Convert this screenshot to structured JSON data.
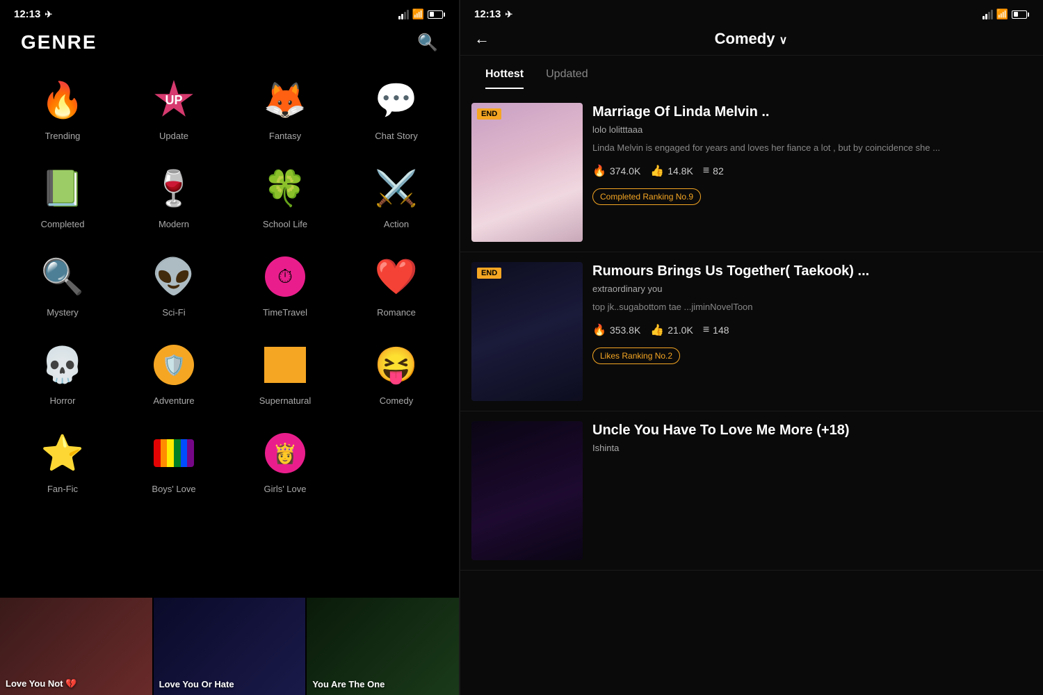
{
  "left": {
    "statusBar": {
      "time": "12:13",
      "location": "↗"
    },
    "title": "GENRE",
    "searchLabel": "search",
    "genres": [
      {
        "id": "trending",
        "label": "Trending",
        "emoji": "🔥"
      },
      {
        "id": "update",
        "label": "Update",
        "emoji": "🔼",
        "special": "UP"
      },
      {
        "id": "fantasy",
        "label": "Fantasy",
        "emoji": "🦊"
      },
      {
        "id": "chat-story",
        "label": "Chat Story",
        "emoji": "💬"
      },
      {
        "id": "completed",
        "label": "Completed",
        "emoji": "📘"
      },
      {
        "id": "modern",
        "label": "Modern",
        "emoji": "🍷"
      },
      {
        "id": "school-life",
        "label": "School Life",
        "emoji": "🍀"
      },
      {
        "id": "action",
        "label": "Action",
        "emoji": "⚔️"
      },
      {
        "id": "mystery",
        "label": "Mystery",
        "emoji": "🔍"
      },
      {
        "id": "sci-fi",
        "label": "Sci-Fi",
        "emoji": "👽"
      },
      {
        "id": "time-travel",
        "label": "TimeTravel",
        "emoji": "⏱️"
      },
      {
        "id": "romance",
        "label": "Romance",
        "emoji": "❤️"
      },
      {
        "id": "horror",
        "label": "Horror",
        "emoji": "💀"
      },
      {
        "id": "adventure",
        "label": "Adventure",
        "emoji": "🛡️"
      },
      {
        "id": "supernatural",
        "label": "Supernatural",
        "emoji": "🔺"
      },
      {
        "id": "comedy",
        "label": "Comedy",
        "emoji": "😝"
      },
      {
        "id": "fan-fic",
        "label": "Fan-Fic",
        "emoji": "⭐"
      },
      {
        "id": "boys-love",
        "label": "Boys' Love",
        "emoji": "🏳️‍🌈"
      },
      {
        "id": "girls-love",
        "label": "Girls' Love",
        "emoji": "👸"
      }
    ],
    "carousel": [
      {
        "id": "c1",
        "label": "Love You Not 💔",
        "bgClass": "c1-bg"
      },
      {
        "id": "c2",
        "label": "Love You Or Hate",
        "bgClass": "c2-bg"
      },
      {
        "id": "c3",
        "label": "You Are The One",
        "bgClass": "c3-bg"
      }
    ]
  },
  "right": {
    "statusBar": {
      "time": "12:13",
      "location": "↗"
    },
    "title": "Comedy",
    "backLabel": "←",
    "tabs": [
      {
        "id": "hottest",
        "label": "Hottest",
        "active": true
      },
      {
        "id": "updated",
        "label": "Updated",
        "active": false
      }
    ],
    "stories": [
      {
        "id": "s1",
        "badge": "END",
        "title": "Marriage Of Linda Melvin ..",
        "author": "lolo lolitttaaa",
        "description": "Linda Melvin is engaged for years and loves her fiance a lot , but by coincidence she ...",
        "fires": "374.0K",
        "likes": "14.8K",
        "chapters": "82",
        "ranking": "Completed Ranking No.9",
        "thumbClass": "thumb-1-content"
      },
      {
        "id": "s2",
        "badge": "END",
        "title": "Rumours Brings Us Together( Taekook) ...",
        "author": "extraordinary you",
        "description": "top jk..sugabottom tae ...jiminNovelToon",
        "fires": "353.8K",
        "likes": "21.0K",
        "chapters": "148",
        "ranking": "Likes Ranking No.2",
        "thumbClass": "thumb-2-content"
      },
      {
        "id": "s3",
        "badge": "",
        "title": "Uncle You Have To Love Me More (+18)",
        "author": "Ishinta",
        "description": "",
        "fires": "",
        "likes": "",
        "chapters": "",
        "ranking": "",
        "thumbClass": "thumb-3-content"
      }
    ]
  }
}
